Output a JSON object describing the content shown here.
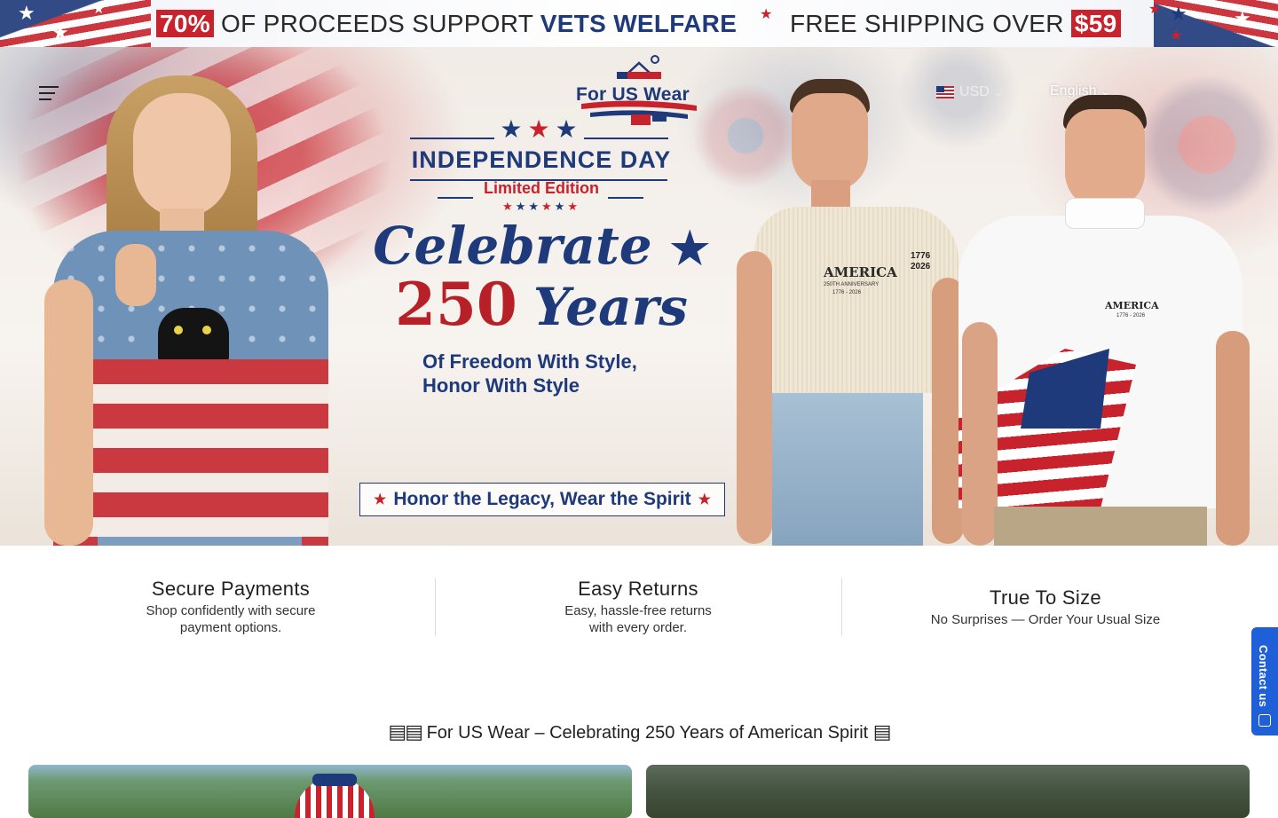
{
  "announcement": {
    "percent": "70%",
    "text1": "OF PROCEEDS SUPPORT",
    "text1_highlight": "VETS WELFARE",
    "text2": "FREE SHIPPING OVER",
    "amount": "$59"
  },
  "header": {
    "logo_text": "For US Wear",
    "currency": "USD",
    "language": "English"
  },
  "hero": {
    "independence": "INDEPENDENCE DAY",
    "limited": "Limited Edition",
    "celebrate": "Celebrate",
    "number": "250",
    "years": "Years",
    "line1": "Of Freedom With Style,",
    "line2": "Honor With Style",
    "legacy": "Honor the Legacy, Wear the Spirit",
    "shirt1_text": "AMERICA",
    "shirt1_sub": "250TH ANNIVERSARY",
    "shirt1_years": "1776 - 2026",
    "sleeve1": "1776",
    "sleeve2": "2026",
    "shirt2_text": "AMERICA",
    "shirt2_years": "1776 - 2026"
  },
  "features": [
    {
      "title": "Secure Payments",
      "desc1": "Shop confidently with secure",
      "desc2": "payment options."
    },
    {
      "title": "Easy Returns",
      "desc1": "Easy, hassle-free returns",
      "desc2": "with every order."
    },
    {
      "title": "True To Size",
      "desc1": "No Surprises — Order Your Usual Size",
      "desc2": ""
    }
  ],
  "contact_tab": "Contact us",
  "section_title": "For US Wear – Celebrating 250 Years of American Spirit",
  "colors": {
    "navy": "#1e3a7a",
    "red": "#c8232c",
    "contact_blue": "#1f5fd8"
  }
}
